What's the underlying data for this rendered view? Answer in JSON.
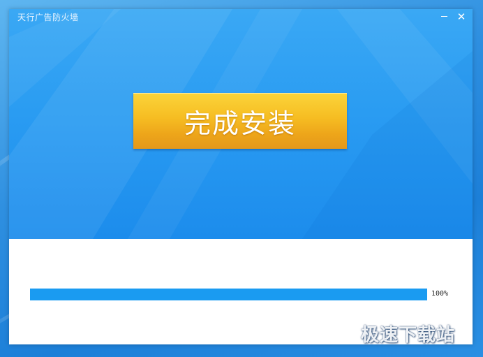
{
  "window": {
    "title": "天行广告防火墙",
    "minimize_icon": "minimize-icon",
    "close_icon": "close-icon",
    "close_glyph": "✕"
  },
  "main": {
    "finish_button_label": "完成安装"
  },
  "progress": {
    "percent": 100,
    "label": "100%",
    "fill_color": "#1a9bf1"
  },
  "watermark": {
    "text": "极速下载站"
  },
  "colors": {
    "banner_blue": "#2a9cf2",
    "button_gold": "#f6bd22"
  }
}
